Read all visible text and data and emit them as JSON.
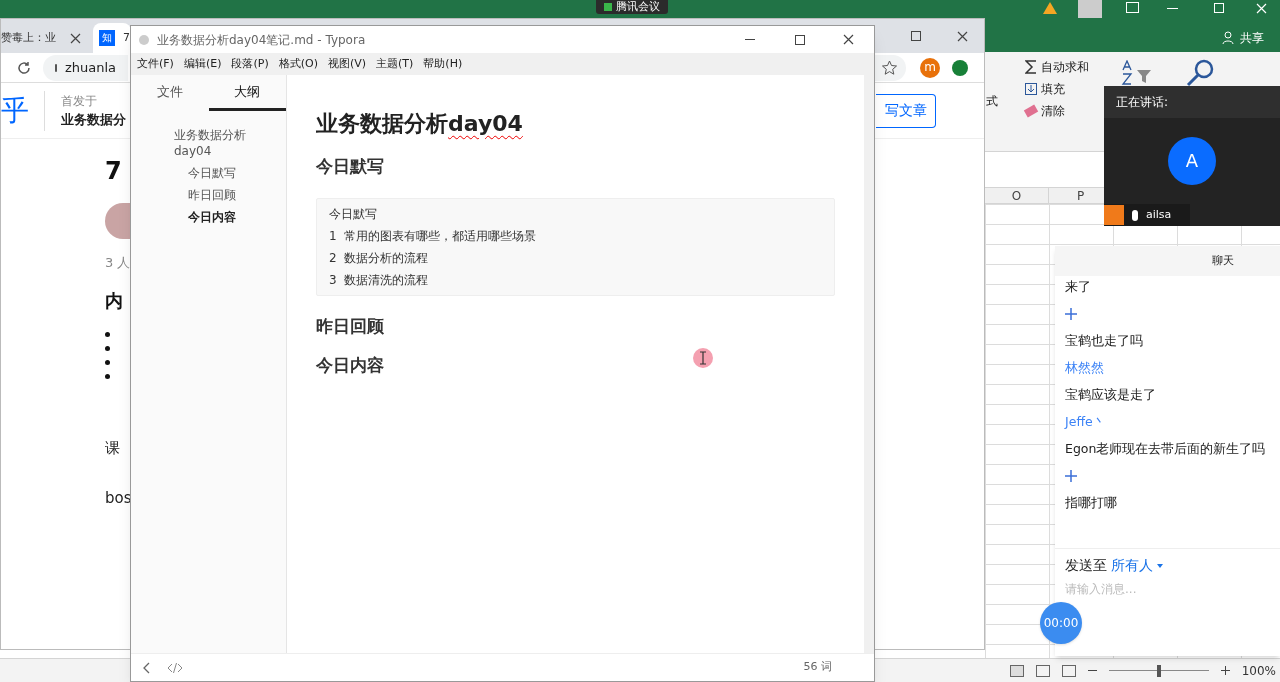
{
  "meeting_badge": "腾讯会议",
  "excel": {
    "share": "共享",
    "ribbon": [
      {
        "label": "自动求和",
        "kind": "sum"
      },
      {
        "label": "填充",
        "kind": "fill"
      },
      {
        "label": "清除",
        "kind": "clear"
      }
    ],
    "format_label": "式",
    "columns": [
      "O",
      "P"
    ],
    "zoom_slider": {
      "level": 0.5
    },
    "zoom": "100%"
  },
  "browser": {
    "tabs": [
      {
        "label": "赞毒上：业",
        "selected": false
      },
      {
        "label": "7",
        "favicon": "知",
        "selected": true
      }
    ],
    "address": "zhuanla",
    "site_logo": "乎",
    "column_label": "首发于",
    "column_name": "业务数据分",
    "write_button": "写文章",
    "profile_letter": "m",
    "article": {
      "title": "7",
      "meta": "3 人",
      "heading": "内",
      "paragraphs": [
        "课",
        "bos"
      ]
    }
  },
  "typora": {
    "title": "业务数据分析day04笔记.md - Typora",
    "menu": [
      "文件(F)",
      "编辑(E)",
      "段落(P)",
      "格式(O)",
      "视图(V)",
      "主题(T)",
      "帮助(H)"
    ],
    "sidebar_tabs": [
      {
        "label": "文件",
        "selected": false
      },
      {
        "label": "大纲",
        "selected": true
      }
    ],
    "outline": [
      {
        "label": "业务数据分析day04",
        "selected": false,
        "children": [
          {
            "label": "今日默写",
            "selected": false
          },
          {
            "label": "昨日回顾",
            "selected": false
          },
          {
            "label": "今日内容",
            "selected": true
          }
        ]
      }
    ],
    "content": [
      {
        "kind": "h1",
        "text": "业务数据分析",
        "misspelled": "day04"
      },
      {
        "kind": "h2",
        "text": "今日默写"
      },
      {
        "kind": "code",
        "lines": [
          "今日默写",
          "1  常用的图表有哪些，都适用哪些场景",
          "2  数据分析的流程",
          "3  数据清洗的流程"
        ]
      },
      {
        "kind": "h2",
        "text": "昨日回顾"
      },
      {
        "kind": "h2",
        "text": "今日内容"
      }
    ],
    "word_count": "56 词"
  },
  "speaker": {
    "label": "正在讲话:",
    "avatar": "A",
    "name": "ailsa"
  },
  "chat": {
    "title": "聊天",
    "messages": [
      {
        "kind": "text",
        "text": "来了"
      },
      {
        "kind": "plus"
      },
      {
        "kind": "text",
        "text": "宝鹤也走了吗"
      },
      {
        "kind": "name",
        "text": "林然然"
      },
      {
        "kind": "text",
        "text": "宝鹤应该是走了"
      },
      {
        "kind": "name",
        "text": "Jeffe丶"
      },
      {
        "kind": "text",
        "text": "Egon老师现在去带后面的新生了吗"
      },
      {
        "kind": "plus"
      },
      {
        "kind": "text",
        "text": "指哪打哪"
      }
    ],
    "send_to_label": "发送至",
    "recipient": "所有人",
    "placeholder": "请输入消息...",
    "timer": "00:00"
  }
}
